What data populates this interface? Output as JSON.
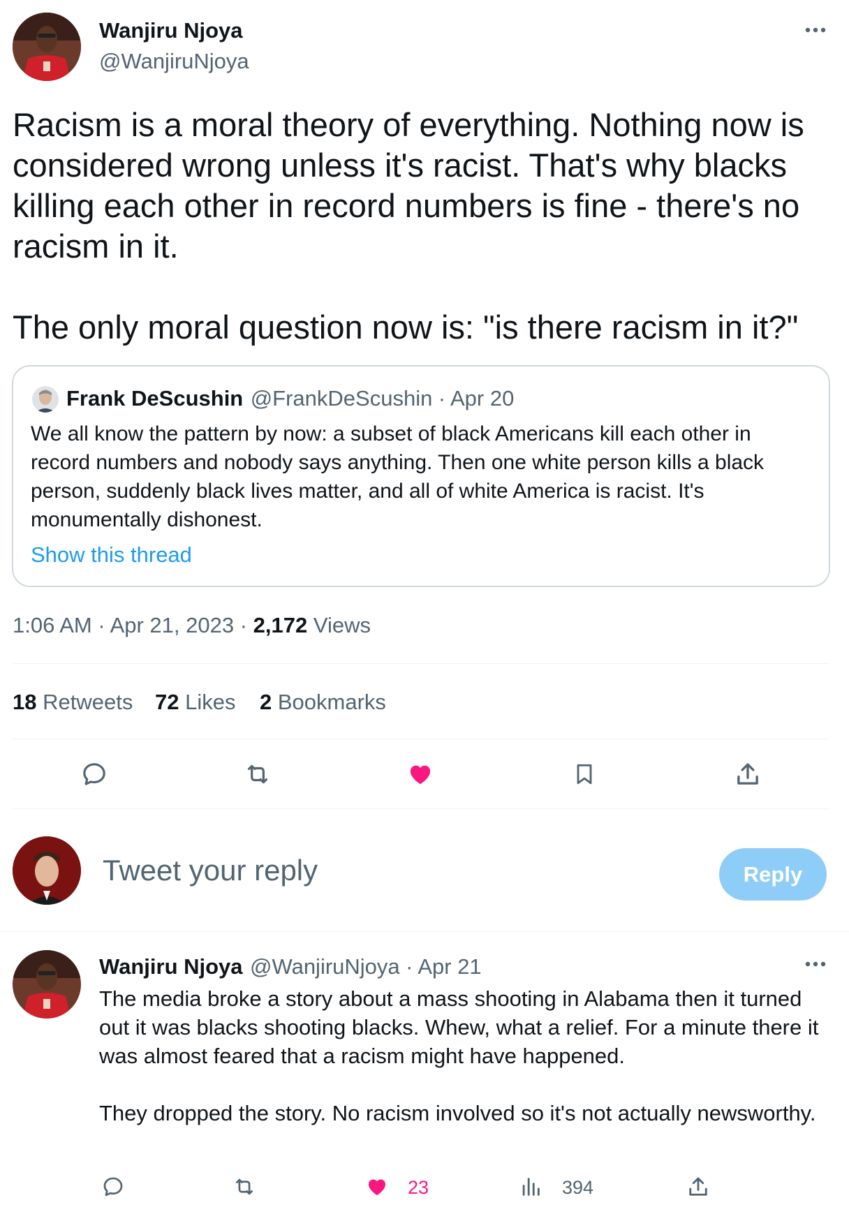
{
  "main_tweet": {
    "author_name": "Wanjiru Njoya",
    "author_handle": "@WanjiruNjoya",
    "text_paragraphs": [
      "Racism is a moral theory of everything. Nothing now is considered wrong unless it's racist. That's why blacks killing each other in record numbers is fine - there's no racism in it.",
      "The only moral question now is: \"is there racism in it?\""
    ],
    "timestamp": "1:06 AM · Apr 21, 2023 ·",
    "views_count": "2,172",
    "views_label": "Views"
  },
  "quoted_tweet": {
    "author_name": "Frank DeScushin",
    "author_handle": "@FrankDeScushin",
    "date": "· Apr 20",
    "text": "We all know the pattern by now: a subset of black Americans kill each other in record numbers and nobody says anything. Then one white person kills a black person, suddenly black lives matter, and all of white America is racist. It's monumentally dishonest.",
    "show_thread_label": "Show this thread"
  },
  "stats": {
    "retweets_count": "18",
    "retweets_label": "Retweets",
    "likes_count": "72",
    "likes_label": "Likes",
    "bookmarks_count": "2",
    "bookmarks_label": "Bookmarks"
  },
  "composer": {
    "placeholder": "Tweet your reply",
    "reply_button": "Reply"
  },
  "reply_tweet": {
    "author_name": "Wanjiru Njoya",
    "author_handle": "@WanjiruNjoya",
    "date": "· Apr 21",
    "text_paragraphs": [
      "The media broke a story about a mass shooting in Alabama then it turned out it was blacks shooting blacks. Whew, what a relief. For a minute there it was almost feared that a racism might have happened.",
      "They dropped the story. No racism involved so it's not actually newsworthy."
    ],
    "likes_count": "23",
    "views_count": "394"
  },
  "colors": {
    "like_active": "#f91880",
    "link": "#1d9bf0",
    "reply_button_disabled": "#8ecdf8",
    "secondary_text": "#536471"
  },
  "icons": {
    "more": "more-horizontal-icon",
    "reply": "comment-icon",
    "retweet": "retweet-icon",
    "like": "heart-filled-icon",
    "bookmark": "bookmark-icon",
    "share": "share-icon",
    "views": "analytics-icon"
  }
}
